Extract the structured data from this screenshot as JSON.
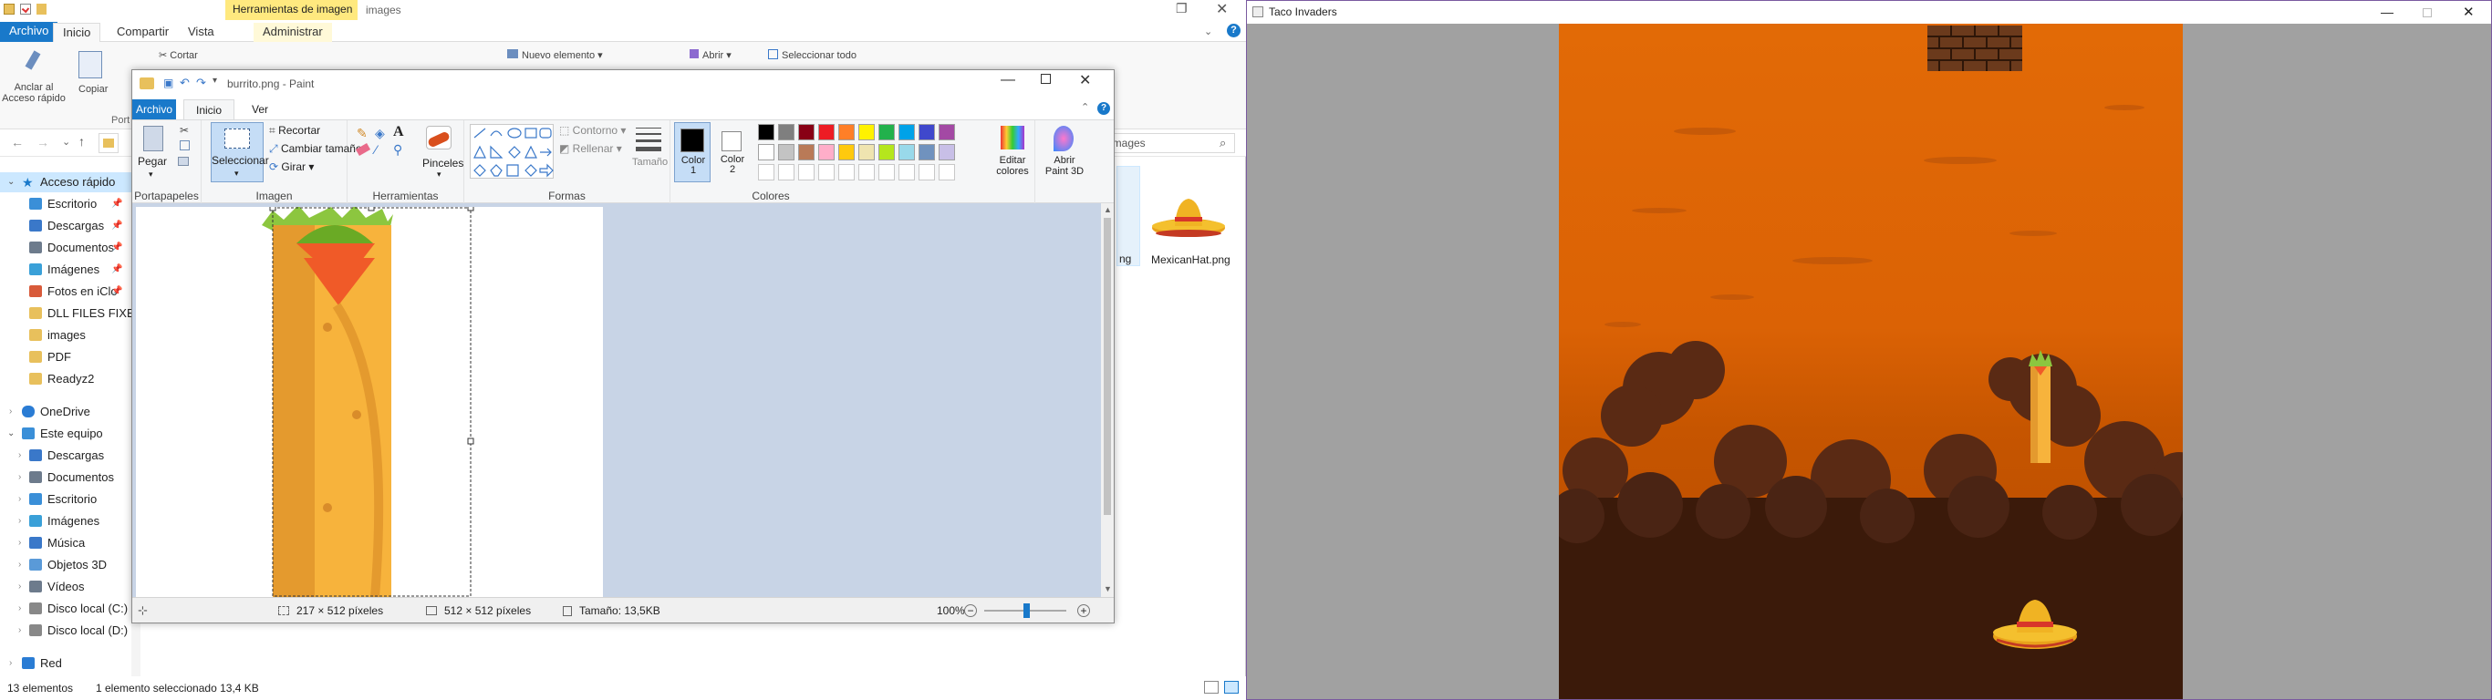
{
  "explorer": {
    "title_tools": "Herramientas de imagen",
    "title_path": "images",
    "tabs": [
      "Archivo",
      "Inicio",
      "Compartir",
      "Vista",
      "Administrar"
    ],
    "ribbon": {
      "pin_label": "Anclar al\nAcceso rápido",
      "copy_label": "Copiar",
      "cut_label": "Cortar",
      "new_item_label": "Nuevo elemento",
      "open_label": "Abrir",
      "select_all_label": "Seleccionar todo",
      "group_label": "Port"
    },
    "search_value": "images",
    "nav": {
      "quick_access": "Acceso rápido",
      "quick_items": [
        "Escritorio",
        "Descargas",
        "Documentos",
        "Imágenes",
        "Fotos en iClo",
        "DLL FILES FIXER",
        "images",
        "PDF",
        "Readyz2"
      ],
      "onedrive": "OneDrive",
      "this_pc": "Este equipo",
      "pc_items": [
        "Descargas",
        "Documentos",
        "Escritorio",
        "Imágenes",
        "Música",
        "Objetos 3D",
        "Vídeos",
        "Disco local (C:)",
        "Disco local (D:)"
      ],
      "network": "Red"
    },
    "files": [
      {
        "name": "MexicanHat.png"
      },
      {
        "name": "ng"
      }
    ],
    "status": {
      "count": "13 elementos",
      "selected": "1 elemento seleccionado  13,4 KB"
    },
    "colors": {
      "accent": "#1979ca",
      "tools_tab": "#ffe97f"
    }
  },
  "paint": {
    "title": "burrito.png - Paint",
    "tabs": [
      "Archivo",
      "Inicio",
      "Ver"
    ],
    "ribbon": {
      "paste": "Pegar",
      "crop": "Recortar",
      "resize": "Cambiar tamaño",
      "rotate": "Girar",
      "select": "Seleccionar",
      "brushes": "Pinceles",
      "outline": "Contorno",
      "fill": "Rellenar",
      "size": "Tamaño",
      "color1": "Color\n1",
      "color2": "Color\n2",
      "edit_colors": "Editar\ncolores",
      "open_paint3d": "Abrir\nPaint 3D",
      "groups": [
        "Portapapeles",
        "Imagen",
        "Herramientas",
        "Formas",
        "Colores"
      ]
    },
    "palette": [
      "#000000",
      "#7f7f7f",
      "#880015",
      "#ed1c24",
      "#ff7f27",
      "#fff200",
      "#22b14c",
      "#00a2e8",
      "#3f48cc",
      "#a349a4",
      "#ffffff",
      "#c3c3c3",
      "#b97a57",
      "#ffaec9",
      "#ffc90e",
      "#efe4b0",
      "#b5e61d",
      "#99d9ea",
      "#7092be",
      "#c8bfe7"
    ],
    "status": {
      "selection_size": "217 × 512 píxeles",
      "image_size": "512 × 512 píxeles",
      "file_size": "Tamaño: 13,5KB",
      "zoom": "100%"
    }
  },
  "game": {
    "title": "Taco Invaders",
    "colors": {
      "sky": "#e26a06",
      "ground": "#3b1a0a",
      "cloud": "#4a2414"
    }
  }
}
